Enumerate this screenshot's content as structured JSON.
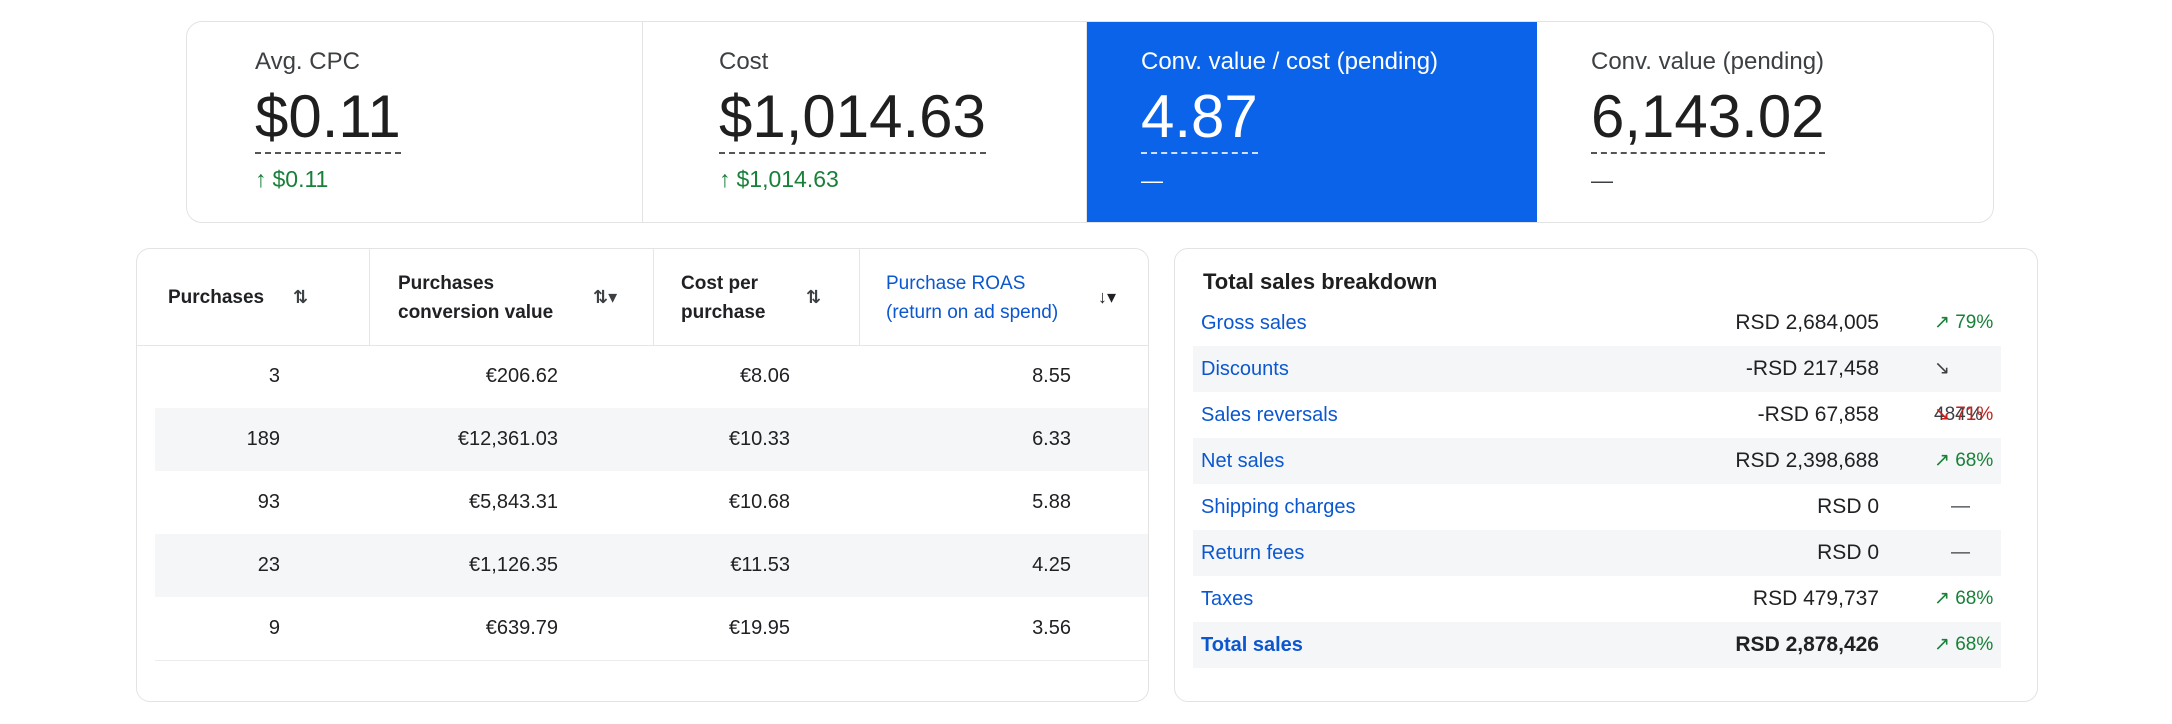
{
  "scorecards": [
    {
      "label": "Avg. CPC",
      "value": "$0.11",
      "delta_arrow": "↑",
      "delta": "$0.11"
    },
    {
      "label": "Cost",
      "value": "$1,014.63",
      "delta_arrow": "↑",
      "delta": "$1,014.63"
    },
    {
      "label": "Conv. value / cost (pending)",
      "value": "4.87",
      "dash": "—"
    },
    {
      "label": "Conv. value (pending)",
      "value": "6,143.02",
      "dash": "—"
    }
  ],
  "table": {
    "headers": [
      {
        "line1": "Purchases",
        "line2": "",
        "sort": "⇅"
      },
      {
        "line1": "Purchases",
        "line2": "conversion value",
        "sort": "⇅▾"
      },
      {
        "line1": "Cost per",
        "line2": "purchase",
        "sort": "⇅"
      },
      {
        "line1": "Purchase ROAS",
        "line2": "(return on ad spend)",
        "sort": "↓▾"
      }
    ],
    "rows": [
      {
        "purchases": "3",
        "conv_value": "€206.62",
        "cost_per": "€8.06",
        "roas": "8.55"
      },
      {
        "purchases": "189",
        "conv_value": "€12,361.03",
        "cost_per": "€10.33",
        "roas": "6.33"
      },
      {
        "purchases": "93",
        "conv_value": "€5,843.31",
        "cost_per": "€10.68",
        "roas": "5.88"
      },
      {
        "purchases": "23",
        "conv_value": "€1,126.35",
        "cost_per": "€11.53",
        "roas": "4.25"
      },
      {
        "purchases": "9",
        "conv_value": "€639.79",
        "cost_per": "€19.95",
        "roas": "3.56"
      }
    ]
  },
  "sales": {
    "title": "Total sales breakdown",
    "rows": [
      {
        "label": "Gross sales",
        "amount": "RSD 2,684,005",
        "pct": "↗ 79%",
        "trend": "up"
      },
      {
        "label": "Discounts",
        "amount": "-RSD 217,458",
        "pct": "↘ 484%",
        "trend": "neutral"
      },
      {
        "label": "Sales reversals",
        "amount": "-RSD 67,858",
        "pct": "↘ 71%",
        "trend": "red"
      },
      {
        "label": "Net sales",
        "amount": "RSD 2,398,688",
        "pct": "↗ 68%",
        "trend": "up"
      },
      {
        "label": "Shipping charges",
        "amount": "RSD 0",
        "pct": "—",
        "trend": "none"
      },
      {
        "label": "Return fees",
        "amount": "RSD 0",
        "pct": "—",
        "trend": "none"
      },
      {
        "label": "Taxes",
        "amount": "RSD 479,737",
        "pct": "↗ 68%",
        "trend": "up"
      },
      {
        "label": "Total sales",
        "amount": "RSD 2,878,426",
        "pct": "↗ 68%",
        "trend": "up"
      }
    ]
  },
  "colors": {
    "accent_blue": "#0b63e9",
    "link_blue": "#0b57d0",
    "positive_green": "#188038",
    "negative_red": "#c5221f"
  }
}
